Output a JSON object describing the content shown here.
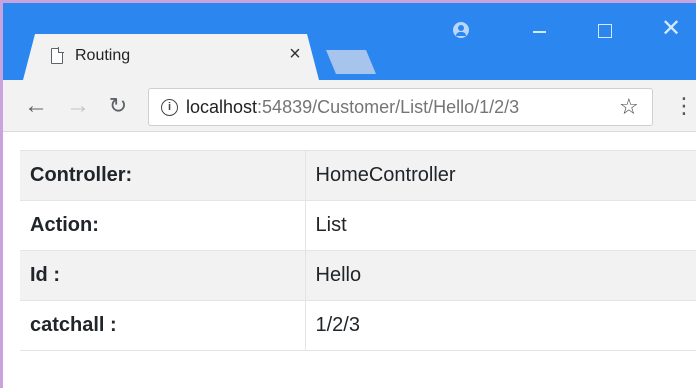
{
  "browser": {
    "tab_title": "Routing",
    "tab_close_glyph": "×",
    "window_close_glyph": "✕",
    "url_host": "localhost",
    "url_rest": ":54839/Customer/List/Hello/1/2/3",
    "back_glyph": "←",
    "forward_glyph": "→",
    "reload_glyph": "↻",
    "star_glyph": "☆",
    "menu_glyph": "⋮",
    "info_glyph": "i",
    "accent_color": "#2b86f0"
  },
  "route_table": {
    "rows": [
      {
        "key": "Controller:",
        "value": "HomeController"
      },
      {
        "key": "Action:",
        "value": "List"
      },
      {
        "key": "Id :",
        "value": "Hello"
      },
      {
        "key": "catchall :",
        "value": "1/2/3"
      }
    ]
  }
}
